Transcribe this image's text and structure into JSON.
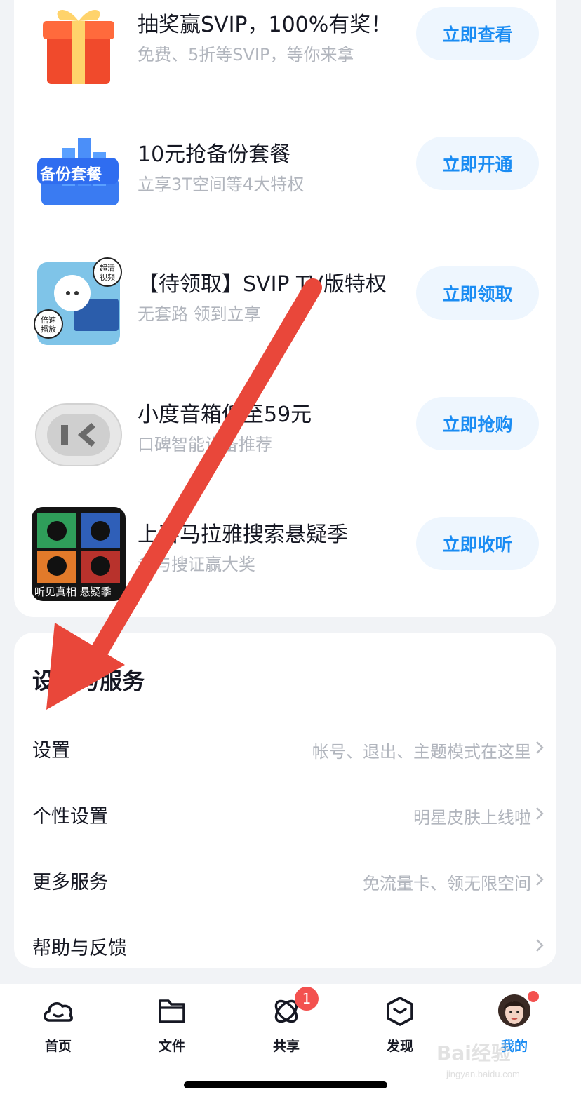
{
  "promos": [
    {
      "title": "抽奖赢SVIP，100%有奖！",
      "subtitle": "免费、5折等SVIP，等你来拿",
      "button": "立即查看",
      "icon": "gift-box-icon"
    },
    {
      "title": "10元抢备份套餐",
      "subtitle": "立享3T空间等4大特权",
      "button": "立即开通",
      "icon": "backup-package-icon",
      "thumb_text": "备份套餐"
    },
    {
      "title": "【待领取】SVIP TV版特权",
      "subtitle": "无套路 领到立享",
      "button": "立即领取",
      "icon": "tv-privilege-icon",
      "bubble_1": "超清视频",
      "bubble_2": "倍速播放"
    },
    {
      "title": "小度音箱低至59元",
      "subtitle": "口碑智能设备推荐",
      "button": "立即抢购",
      "icon": "smart-speaker-icon"
    },
    {
      "title": "上喜马拉雅搜索悬疑季",
      "subtitle": "参与搜证赢大奖",
      "button": "立即收听",
      "icon": "mystery-season-poster",
      "thumb_text": "听见真相 悬疑季"
    }
  ],
  "settings_section": {
    "title": "设置与服务",
    "items": [
      {
        "label": "设置",
        "hint": "帐号、退出、主题模式在这里"
      },
      {
        "label": "个性设置",
        "hint": "明星皮肤上线啦"
      },
      {
        "label": "更多服务",
        "hint": "免流量卡、领无限空间"
      },
      {
        "label": "帮助与反馈",
        "hint": ""
      }
    ]
  },
  "tabbar": {
    "tabs": [
      {
        "label": "首页",
        "icon": "cloud-home-icon"
      },
      {
        "label": "文件",
        "icon": "folder-icon"
      },
      {
        "label": "共享",
        "icon": "share-orbit-icon"
      },
      {
        "label": "发现",
        "icon": "discover-cube-icon"
      },
      {
        "label": "我的",
        "icon": "avatar-icon",
        "active": true
      }
    ],
    "share_badge": "1"
  },
  "watermark": {
    "logo": "Bai经验",
    "url": "jingyan.baidu.com"
  },
  "colors": {
    "accent": "#1a8cf3",
    "button_bg": "#eef6fe",
    "badge": "#f3514f",
    "arrow": "#e9473a"
  }
}
